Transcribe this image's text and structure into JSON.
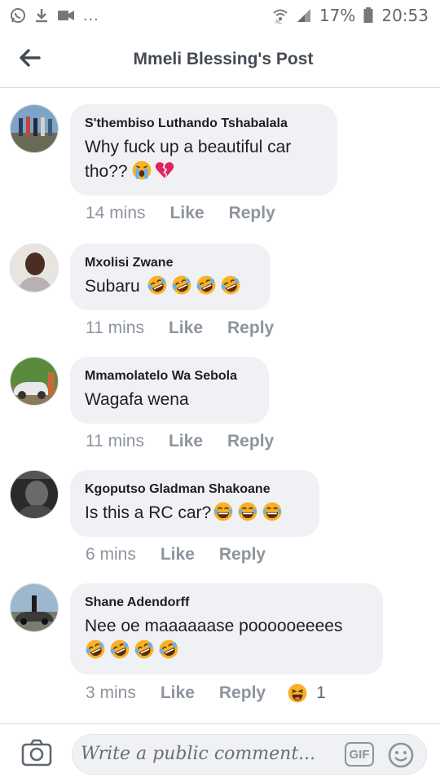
{
  "status_bar": {
    "battery_percent": "17%",
    "time": "20:53",
    "left_icons": [
      "whatsapp-icon",
      "download-icon",
      "video-camera-icon"
    ],
    "more": "...",
    "right_icons": [
      "wifi-icon",
      "signal-icon",
      "battery-icon"
    ]
  },
  "header": {
    "title": "Mmeli Blessing's Post",
    "back_icon": "back-arrow-icon"
  },
  "comments": [
    {
      "author": "S'thembiso Luthando Tshabalala",
      "text_line1": "Why fuck up a beautiful car",
      "text_line2": "tho??",
      "emojis": [
        "loudly-crying-face",
        "broken-heart"
      ],
      "time": "14 mins",
      "like": "Like",
      "reply": "Reply"
    },
    {
      "author": "Mxolisi Zwane",
      "text_line1": "Subaru",
      "emojis": [
        "rolling-on-floor-laughing",
        "rolling-on-floor-laughing",
        "rolling-on-floor-laughing",
        "rolling-on-floor-laughing"
      ],
      "time": "11 mins",
      "like": "Like",
      "reply": "Reply"
    },
    {
      "author": "Mmamolatelo Wa Sebola",
      "text_line1": "Wagafa wena",
      "emojis": [],
      "time": "11 mins",
      "like": "Like",
      "reply": "Reply"
    },
    {
      "author": "Kgoputso Gladman Shakoane",
      "text_line1": "Is this a RC car?",
      "emojis": [
        "face-with-tears-of-joy",
        "face-with-tears-of-joy",
        "face-with-tears-of-joy"
      ],
      "time": "6 mins",
      "like": "Like",
      "reply": "Reply"
    },
    {
      "author": "Shane Adendorff",
      "text_line1": "Nee oe maaaaaase poooooeeees",
      "emojis": [
        "rolling-on-floor-laughing",
        "rolling-on-floor-laughing",
        "rolling-on-floor-laughing",
        "rolling-on-floor-laughing"
      ],
      "time": "3 mins",
      "like": "Like",
      "reply": "Reply",
      "reaction": {
        "icon": "haha-reaction-icon",
        "count": "1"
      }
    }
  ],
  "composer": {
    "placeholder": "Write a public comment...",
    "gif_label": "GIF",
    "camera_icon": "camera-icon",
    "sticker_icon": "smiley-icon"
  },
  "colors": {
    "bubble": "#f0f1f4",
    "meta_text": "#8d949e",
    "emoji_yellow": "#f7b125",
    "broken_heart": "#e0245e"
  }
}
